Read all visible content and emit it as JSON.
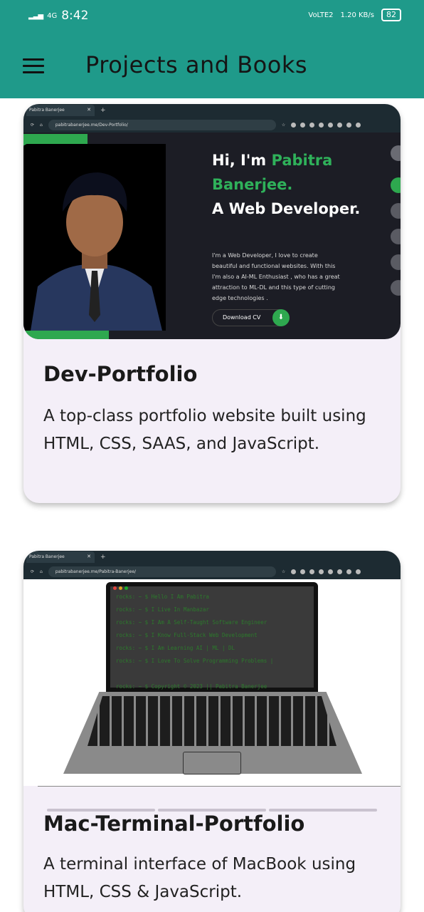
{
  "status": {
    "network": "4G",
    "time": "8:42",
    "volte": "VoLTE2",
    "speed": "1.20 KB/s",
    "battery": "82"
  },
  "appbar": {
    "title": "Projects and Books"
  },
  "projects": [
    {
      "title": "Dev-Portfolio",
      "description": "A top-class portfolio website built using HTML, CSS, SAAS, and JavaScript.",
      "preview": {
        "tab_title": "Pabitra Banerjee",
        "url": "pabitrabanerjee.me/Dev-Portfolio/",
        "hello_prefix": "Hi, I'm ",
        "name": "Pabitra Banerjee.",
        "role": "A Web Developer.",
        "intro": "I'm a Web Developer, I love to create beautiful and functional websites. With this I'm also a AI-ML Enthusiast , who has a great attraction to ML-DL and this type of cutting edge technologies .",
        "cv_button": "Download CV"
      }
    },
    {
      "title": "Mac-Terminal-Portfolio",
      "description": "A terminal interface of MacBook using HTML, CSS & JavaScript.",
      "preview": {
        "tab_title": "Pabitra Banerjee",
        "url": "pabitrabanerjee.me/Pabitra-Banerjee/",
        "terminal_lines": [
          "rocks: ~ $ Hello I Am Pabitra",
          "rocks: ~ $ I Live In Manbazar",
          "rocks: ~ $ I Am A Self-Taught Software Engineer",
          "rocks: ~ $ I Know Full-Stack Web Development",
          "rocks: ~ $ I Am Learning AI | ML | DL",
          "rocks: ~ $ I Love To Solve Programming Problems |",
          "",
          "rocks: ~ $ Copyright © 2023 || Pabitra Banerjee"
        ]
      }
    }
  ],
  "colors": {
    "appbar": "#1f9a8a",
    "card": "#f4eff8",
    "accent_green": "#2ea84f"
  }
}
